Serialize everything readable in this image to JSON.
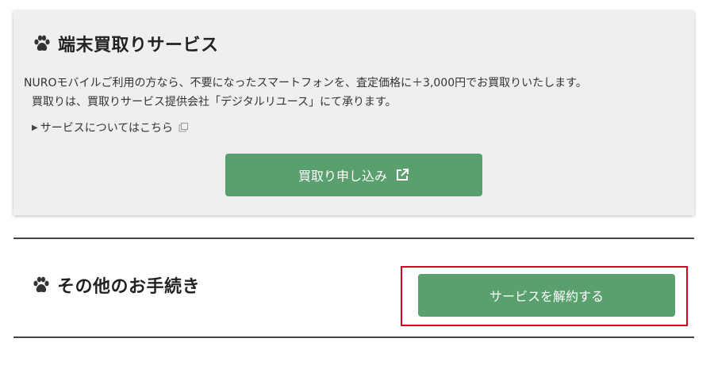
{
  "trade_in": {
    "title": "端末買取りサービス",
    "description_line1": "NUROモバイルご利用の方なら、不要になったスマートフォンを、査定価格に＋3,000円でお買取りいたします。",
    "description_line2": "買取りは、買取りサービス提供会社「デジタルリユース」にて承ります。",
    "service_link_label": "サービスについてはこちら",
    "apply_button_label": "買取り申し込み"
  },
  "other_procedures": {
    "title": "その他のお手続き",
    "cancel_button_label": "サービスを解約する"
  },
  "colors": {
    "button_green": "#5a9f6e",
    "card_background": "#eeefef",
    "highlight_red": "#d8001a"
  }
}
